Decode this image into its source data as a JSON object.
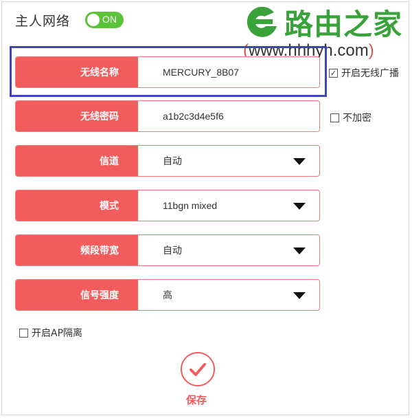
{
  "header": {
    "title": "主人网络",
    "toggle_label": "ON"
  },
  "watermark": {
    "brand": "路由之家",
    "url_open": "(",
    "url": "www.hhhyh.com",
    "url_close": ")"
  },
  "fields": [
    {
      "label": "无线名称",
      "value": "MERCURY_8B07"
    },
    {
      "label": "无线密码",
      "value": "a1b2c3d4e5f6"
    },
    {
      "label": "信道",
      "value": "自动"
    },
    {
      "label": "模式",
      "value": "11bgn mixed"
    },
    {
      "label": "频段带宽",
      "value": "自动"
    },
    {
      "label": "信号强度",
      "value": "高"
    }
  ],
  "checkboxes": {
    "broadcast": {
      "label": "开启无线广播",
      "checked": true,
      "mark": "✓"
    },
    "no_encrypt": {
      "label": "不加密",
      "checked": false
    },
    "ap_isolation": {
      "label": "开启AP隔离",
      "checked": false
    }
  },
  "save": {
    "label": "保存"
  },
  "colors": {
    "accent": "#f25c5c",
    "toggle": "#5ac33a",
    "highlight": "#3c44b8",
    "brand": "#3aa23a"
  }
}
